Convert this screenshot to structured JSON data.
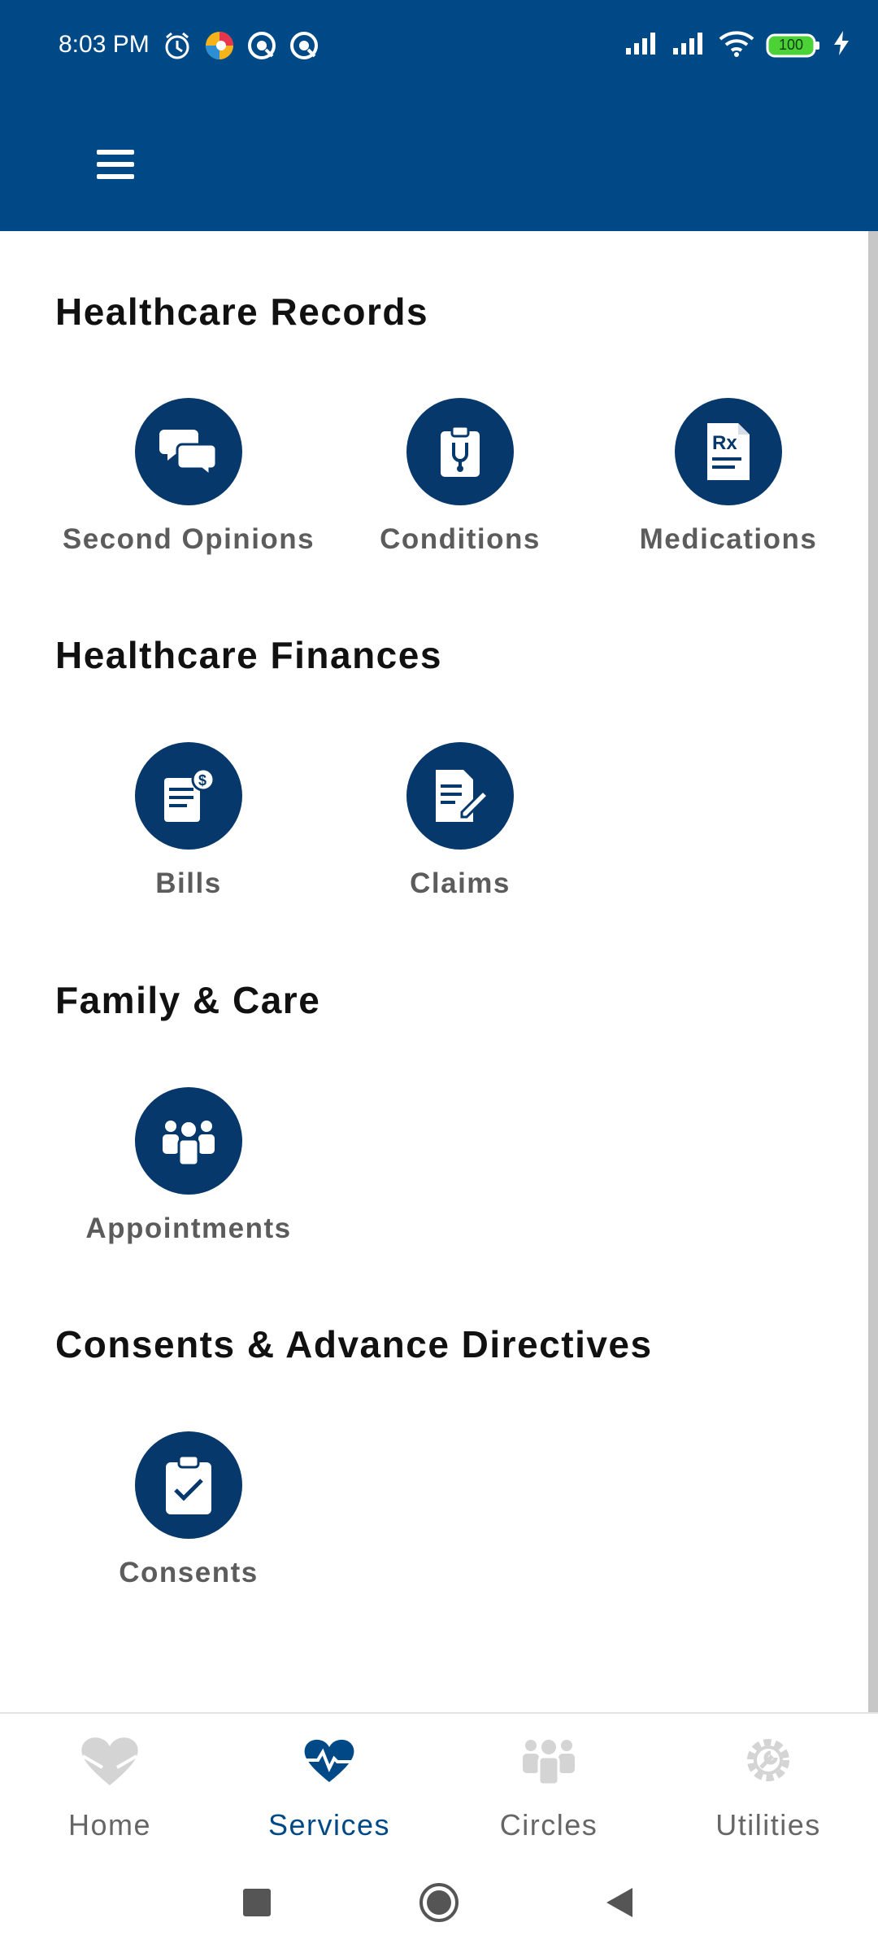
{
  "status": {
    "time": "8:03 PM",
    "battery": "100",
    "icons": [
      "alarm-icon",
      "app-icon-colorful",
      "app-icon-1",
      "app-icon-2",
      "signal-icon",
      "signal-icon",
      "wifi-icon",
      "battery-icon",
      "charging-icon"
    ]
  },
  "appbar": {
    "menu_icon": "menu-icon"
  },
  "colors": {
    "primary": "#004987",
    "icon_circle": "#06386b",
    "inactive": "#c8c8c8"
  },
  "sections": [
    {
      "title": "Healthcare Records",
      "items": [
        {
          "label": "Second Opinions",
          "icon": "chat-bubbles-icon"
        },
        {
          "label": "Conditions",
          "icon": "clipboard-stethoscope-icon"
        },
        {
          "label": "Medications",
          "icon": "prescription-icon"
        }
      ]
    },
    {
      "title": "Healthcare Finances",
      "items": [
        {
          "label": "Bills",
          "icon": "bill-dollar-icon"
        },
        {
          "label": "Claims",
          "icon": "claim-edit-icon"
        }
      ]
    },
    {
      "title": "Family & Care",
      "items": [
        {
          "label": "Appointments",
          "icon": "people-group-icon"
        }
      ]
    },
    {
      "title": "Consents & Advance Directives",
      "items": [
        {
          "label": "Consents",
          "icon": "clipboard-check-icon"
        }
      ]
    }
  ],
  "bottom_nav": [
    {
      "label": "Home",
      "icon": "heart-hands-icon",
      "active": false
    },
    {
      "label": "Services",
      "icon": "heart-pulse-icon",
      "active": true
    },
    {
      "label": "Circles",
      "icon": "people-group-icon",
      "active": false
    },
    {
      "label": "Utilities",
      "icon": "gear-wrench-icon",
      "active": false
    }
  ],
  "system_nav": [
    "recents-icon",
    "home-circle-icon",
    "back-triangle-icon"
  ]
}
